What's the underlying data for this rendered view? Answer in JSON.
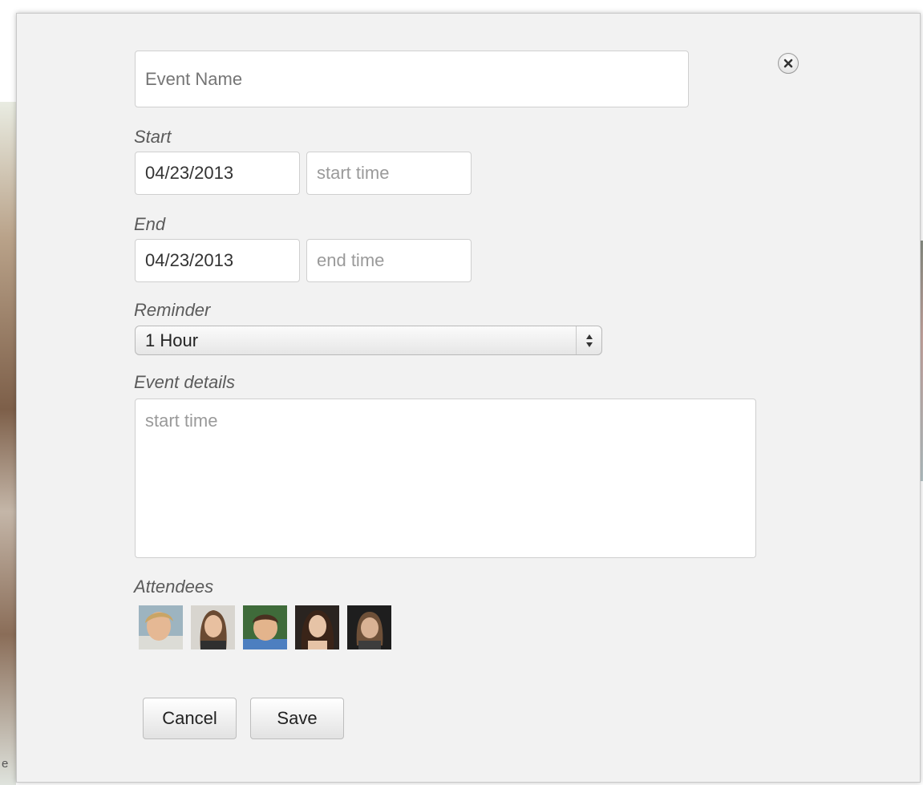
{
  "form": {
    "event_name": {
      "value": "",
      "placeholder": "Event Name"
    },
    "start": {
      "label": "Start",
      "date_value": "04/23/2013",
      "time_placeholder": "start time"
    },
    "end": {
      "label": "End",
      "date_value": "04/23/2013",
      "time_placeholder": "end time"
    },
    "reminder": {
      "label": "Reminder",
      "selected": "1 Hour"
    },
    "details": {
      "label": "Event details",
      "placeholder": "start time"
    },
    "attendees": {
      "label": "Attendees",
      "avatars": [
        {
          "icon": "avatar-photo-1"
        },
        {
          "icon": "avatar-photo-2"
        },
        {
          "icon": "avatar-photo-3"
        },
        {
          "icon": "avatar-photo-4"
        },
        {
          "icon": "avatar-photo-5"
        }
      ]
    },
    "buttons": {
      "cancel_label": "Cancel",
      "save_label": "Save"
    }
  },
  "close_icon": "close-icon",
  "background": {
    "edge_text": "e"
  },
  "colors": {
    "modal_bg": "#f2f2f2",
    "label_text": "#5b5b5b",
    "placeholder_text": "#9a9a9a"
  }
}
